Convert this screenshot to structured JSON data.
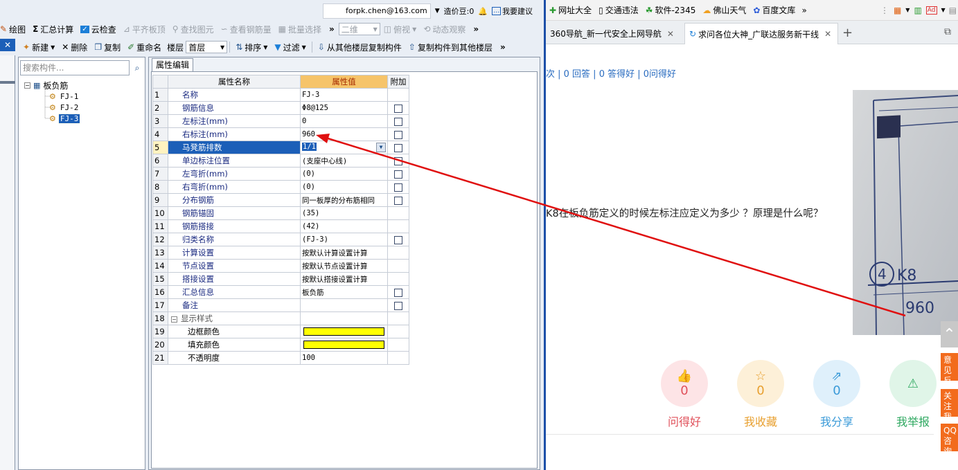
{
  "account": {
    "email": "forpk.chen@163.com",
    "cost_label": "造价豆:0",
    "feedback": "我要建议"
  },
  "toolbar1": {
    "draw": "绘图",
    "summary": "汇总计算",
    "cloud_check": "云检查",
    "flat_slab": "平齐板顶",
    "find_element": "查找图元",
    "view_rebar": "查看钢筋量",
    "batch_select": "批量选择",
    "view_mode": "二维",
    "view_angle": "俯视",
    "dynamic_view": "动态观察"
  },
  "toolbar2": {
    "new": "新建",
    "delete": "删除",
    "copy": "复制",
    "rename": "重命名",
    "floor_label": "楼层",
    "floor_value": "首层",
    "sort": "排序",
    "filter": "过滤",
    "copy_from": "从其他楼层复制构件",
    "copy_to": "复制构件到其他楼层"
  },
  "tree": {
    "search_placeholder": "搜索构件...",
    "root": "板负筋",
    "items": [
      "FJ-1",
      "FJ-2",
      "FJ-3"
    ]
  },
  "props": {
    "tab": "属性编辑",
    "headers": [
      "属性名称",
      "属性值",
      "附加"
    ],
    "rows": [
      {
        "n": "1",
        "name": "名称",
        "value": "FJ-3"
      },
      {
        "n": "2",
        "name": "钢筋信息",
        "value": "Φ8@125"
      },
      {
        "n": "3",
        "name": "左标注(mm)",
        "value": "0"
      },
      {
        "n": "4",
        "name": "右标注(mm)",
        "value": "960"
      },
      {
        "n": "5",
        "name": "马凳筋排数",
        "value": "1/1"
      },
      {
        "n": "6",
        "name": "单边标注位置",
        "value": "(支座中心线)"
      },
      {
        "n": "7",
        "name": "左弯折(mm)",
        "value": "(0)"
      },
      {
        "n": "8",
        "name": "右弯折(mm)",
        "value": "(0)"
      },
      {
        "n": "9",
        "name": "分布钢筋",
        "value": "同一板厚的分布筋相同"
      },
      {
        "n": "10",
        "name": "钢筋锚固",
        "value": "(35)"
      },
      {
        "n": "11",
        "name": "钢筋搭接",
        "value": "(42)"
      },
      {
        "n": "12",
        "name": "归类名称",
        "value": "(FJ-3)"
      },
      {
        "n": "13",
        "name": "计算设置",
        "value": "按默认计算设置计算"
      },
      {
        "n": "14",
        "name": "节点设置",
        "value": "按默认节点设置计算"
      },
      {
        "n": "15",
        "name": "搭接设置",
        "value": "按默认搭接设置计算"
      },
      {
        "n": "16",
        "name": "汇总信息",
        "value": "板负筋"
      },
      {
        "n": "17",
        "name": "备注",
        "value": ""
      },
      {
        "n": "18",
        "name": "显示样式",
        "value": ""
      },
      {
        "n": "19",
        "name": "边框颜色",
        "value": ""
      },
      {
        "n": "20",
        "name": "填充颜色",
        "value": ""
      },
      {
        "n": "21",
        "name": "不透明度",
        "value": "100"
      }
    ],
    "swatch_color": "#ffff00"
  },
  "browser": {
    "bookmarks": [
      "网址大全",
      "交通违法",
      "软件-2345",
      "佛山天气",
      "百度文库"
    ],
    "tabs": [
      "360导航_新一代安全上网导航",
      "求问各位大神_广联达服务新干线"
    ],
    "stats": "次 | 0 回答 | 0 答得好 | 0问得好",
    "question": "K8在板负筋定义的时候左标注应定义为多少 ？原理是什么呢？",
    "photo_texts": [
      "4",
      "K8",
      "960"
    ],
    "actions": [
      {
        "label": "问得好",
        "count": "0",
        "color": "#e0505a"
      },
      {
        "label": "我收藏",
        "count": "0",
        "color": "#e8a030"
      },
      {
        "label": "我分享",
        "count": "0",
        "color": "#3a9ad8"
      },
      {
        "label": "我举报",
        "count": "",
        "color": "#2ea860"
      }
    ],
    "side": [
      "意见反馈",
      "关注我们",
      "QQ咨询"
    ]
  },
  "annotation_color": "#e01010"
}
